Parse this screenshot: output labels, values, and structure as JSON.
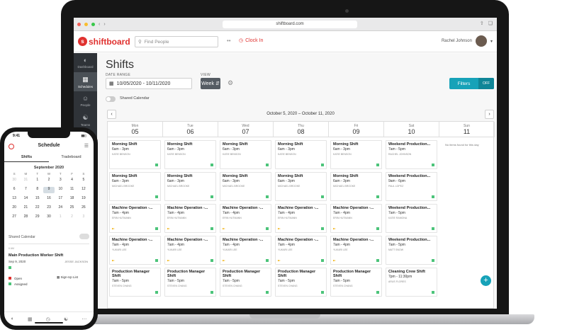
{
  "browser": {
    "url": "shiftboard.com"
  },
  "header": {
    "brand": "shiftboard",
    "search_placeholder": "Find People",
    "clock_in": "Clock In",
    "user_name": "Rachel Johnson"
  },
  "sidenav": {
    "items": [
      {
        "label": "Dashboard",
        "icon": "dashboard-icon"
      },
      {
        "label": "Schedules",
        "icon": "calendar-icon",
        "active": true
      },
      {
        "label": "People",
        "icon": "person-icon"
      },
      {
        "label": "Teams",
        "icon": "teams-icon"
      }
    ]
  },
  "main": {
    "title": "Shifts",
    "date_range_label": "DATE RANGE",
    "date_range_value": "10/05/2020 - 10/11/2020",
    "view_label": "VIEW",
    "view_value": "Week",
    "filters_label": "Filters",
    "filters_state": "OFF",
    "shared_calendar": "Shared Calendar",
    "week_range": "October 5, 2020 – October 11, 2020",
    "days": [
      {
        "name": "Mon",
        "num": "05"
      },
      {
        "name": "Tue",
        "num": "06"
      },
      {
        "name": "Wed",
        "num": "07"
      },
      {
        "name": "Thu",
        "num": "08"
      },
      {
        "name": "Fri",
        "num": "09"
      },
      {
        "name": "Sat",
        "num": "10"
      },
      {
        "name": "Sun",
        "num": "11"
      }
    ],
    "rows": [
      [
        {
          "title": "Morning Shift",
          "time": "6am - 3pm",
          "person": "KATIE BENSON",
          "status": "filled"
        },
        {
          "title": "Morning Shift",
          "time": "6am - 3pm",
          "person": "KATIE BENSON",
          "status": "filled"
        },
        {
          "title": "Morning Shift",
          "time": "6am - 3pm",
          "person": "KATIE BENSON",
          "status": "filled"
        },
        {
          "title": "Morning Shift",
          "time": "6am - 3pm",
          "person": "KATIE BENSON",
          "status": "filled"
        },
        {
          "title": "Morning Shift",
          "time": "6am - 3pm",
          "person": "KATIE BENSON",
          "status": "filled"
        },
        {
          "title": "Weekend Production...",
          "time": "7am - 5pm",
          "person": "RACHEL JOHNSON",
          "status": "filled"
        }
      ],
      [
        {
          "title": "Morning Shift",
          "time": "6am - 3pm",
          "person": "MICHAEL BROOKE",
          "status": "filled"
        },
        {
          "title": "Morning Shift",
          "time": "6am - 3pm",
          "person": "MICHAEL BROOKE",
          "status": "filled"
        },
        {
          "title": "Morning Shift",
          "time": "6am - 3pm",
          "person": "MICHAEL BROOKE",
          "status": "filled"
        },
        {
          "title": "Morning Shift",
          "time": "6am - 3pm",
          "person": "MICHAEL BROOKE",
          "status": "filled"
        },
        {
          "title": "Morning Shift",
          "time": "6am - 3pm",
          "person": "MICHAEL BROOKE",
          "status": "filled"
        },
        {
          "title": "Weekend Production...",
          "time": "9am - 6pm",
          "person": "PAUL LOPEZ",
          "status": "filled"
        }
      ],
      [
        {
          "title": "Machine Operation -...",
          "time": "7am - 4pm",
          "person": "ERIN HUTMANN",
          "status": "flag"
        },
        {
          "title": "Machine Operation -...",
          "time": "7am - 4pm",
          "person": "ERIN HUTMANN",
          "status": "flag"
        },
        {
          "title": "Machine Operation -...",
          "time": "7am - 4pm",
          "person": "ERIN HUTMANN",
          "status": "flag"
        },
        {
          "title": "Machine Operation -...",
          "time": "7am - 4pm",
          "person": "ERIN HUTMANN",
          "status": "flag"
        },
        {
          "title": "Machine Operation -...",
          "time": "7am - 4pm",
          "person": "ERIN HUTMANN",
          "status": "flag"
        },
        {
          "title": "Weekend Production...",
          "time": "7am - 5pm",
          "person": "KATIE RAMONA",
          "status": "filled"
        }
      ],
      [
        {
          "title": "Machine Operation -...",
          "time": "7am - 4pm",
          "person": "YUKARI LEE",
          "status": "flag"
        },
        {
          "title": "Machine Operation -...",
          "time": "7am - 4pm",
          "person": "YUKARI LEE",
          "status": "flag"
        },
        {
          "title": "Machine Operation -...",
          "time": "7am - 4pm",
          "person": "YUKARI LEE",
          "status": "flag"
        },
        {
          "title": "Machine Operation -...",
          "time": "7am - 4pm",
          "person": "YUKARI LEE",
          "status": "flag"
        },
        {
          "title": "Machine Operation -...",
          "time": "7am - 4pm",
          "person": "YUKARI LEE",
          "status": "flag"
        },
        {
          "title": "Weekend Production...",
          "time": "7am - 5pm",
          "person": "MATT SNOW",
          "status": "filled"
        }
      ],
      [
        {
          "title": "Production Manager Shift",
          "time": "7am - 5pm",
          "person": "STEVEN CHANG",
          "status": "filled"
        },
        {
          "title": "Production Manager Shift",
          "time": "7am - 5pm",
          "person": "STEVEN CHANG",
          "status": "filled"
        },
        {
          "title": "Production Manager Shift",
          "time": "7am - 5pm",
          "person": "STEVEN CHANG",
          "status": "filled"
        },
        {
          "title": "Production Manager Shift",
          "time": "7am - 5pm",
          "person": "STEVEN CHANG",
          "status": "filled"
        },
        {
          "title": "Production Manager Shift",
          "time": "7am - 5pm",
          "person": "STEVEN CHANG",
          "status": "filled"
        },
        {
          "title": "Cleaning Crew Shift",
          "time": "7pm - 11:30pm",
          "person": "ARUS FLORES",
          "status": "filled"
        }
      ]
    ],
    "sunday_empty": "No items found for this day"
  },
  "phone": {
    "time": "9:41",
    "title": "Schedule",
    "tabs": [
      "Shifts",
      "Tradeboard"
    ],
    "month": "September 2020",
    "dow": [
      "S",
      "M",
      "T",
      "W",
      "T",
      "F",
      "S"
    ],
    "calendar_days": [
      "30",
      "31",
      "1",
      "2",
      "3",
      "4",
      "5",
      "6",
      "7",
      "8",
      "9",
      "10",
      "11",
      "12",
      "13",
      "14",
      "15",
      "16",
      "17",
      "18",
      "19",
      "20",
      "21",
      "22",
      "23",
      "24",
      "25",
      "26",
      "27",
      "28",
      "29",
      "30",
      "1",
      "2",
      "3"
    ],
    "shared_calendar": "Shared Calendar",
    "time_marker": "6 AM",
    "shift_title": "Main Production Worker Shift",
    "shift_date": "Sep 9, 2020",
    "shift_person": "JESSE JACKSON",
    "legend": [
      {
        "label": "Open",
        "color": "#e0312f"
      },
      {
        "label": "Assigned",
        "color": "#4cc47a"
      }
    ],
    "signup": "Sign-Up List"
  },
  "colors": {
    "brand": "#e0312f",
    "accent": "#17a2b8",
    "filled": "#4cc47a",
    "flag": "#f2b822"
  }
}
